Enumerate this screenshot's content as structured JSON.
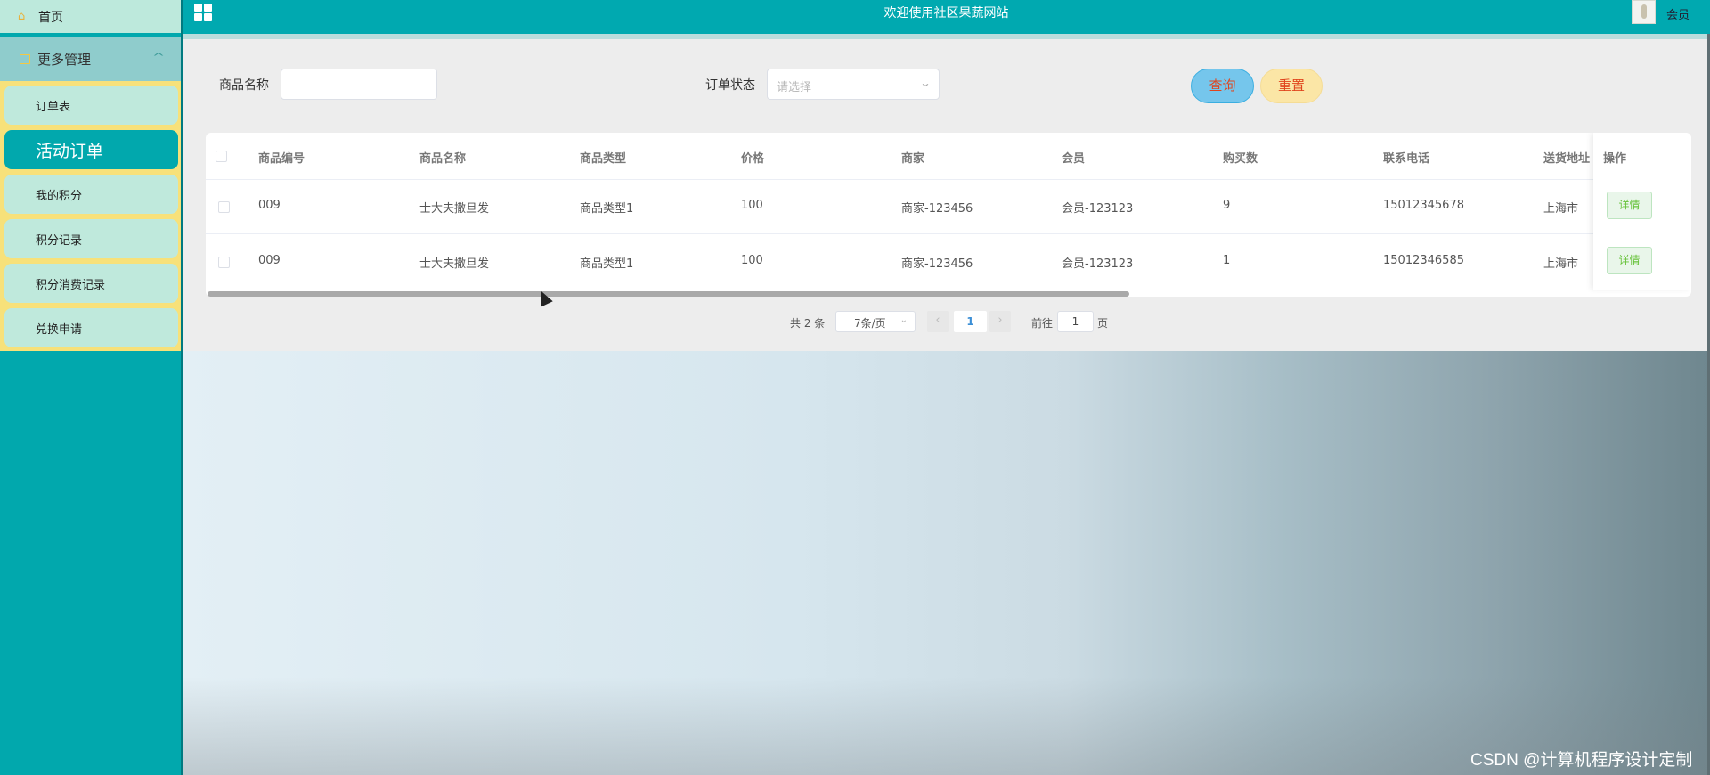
{
  "header": {
    "title": "欢迎使用社区果蔬网站",
    "user_role": "会员"
  },
  "sidebar": {
    "home_label": "首页",
    "group_label": "更多管理",
    "items": [
      {
        "label": "订单表",
        "active": false
      },
      {
        "label": "活动订单",
        "active": true
      },
      {
        "label": "我的积分",
        "active": false
      },
      {
        "label": "积分记录",
        "active": false
      },
      {
        "label": "积分消费记录",
        "active": false
      },
      {
        "label": "兑换申请",
        "active": false
      }
    ]
  },
  "search": {
    "product_name_label": "商品名称",
    "product_name_value": "",
    "order_status_label": "订单状态",
    "order_status_placeholder": "请选择",
    "query_label": "查询",
    "reset_label": "重置"
  },
  "table": {
    "columns": [
      "商品编号",
      "商品名称",
      "商品类型",
      "价格",
      "商家",
      "会员",
      "购买数",
      "联系电话",
      "送货地址",
      "操作"
    ],
    "rows": [
      [
        "009",
        "士大夫撒旦发",
        "商品类型1",
        "100",
        "商家-123456",
        "会员-123123",
        "9",
        "15012345678",
        "上海市",
        "详情"
      ],
      [
        "009",
        "士大夫撒旦发",
        "商品类型1",
        "100",
        "商家-123456",
        "会员-123123",
        "1",
        "15012346585",
        "上海市",
        "详情"
      ]
    ]
  },
  "pagination": {
    "total_text": "共 2 条",
    "page_size": "7条/页",
    "prev": "‹",
    "current_page": "1",
    "next": "›",
    "goto_label": "前往",
    "goto_value": "1",
    "page_unit": "页"
  },
  "watermark": "CSDN @计算机程序设计定制",
  "colors": {
    "primary": "#00a9b0",
    "submenu_bg": "#f7e17a",
    "query_btn": "#75c6ec",
    "reset_btn": "#fbe6a6",
    "detail_green": "#67c23a"
  }
}
